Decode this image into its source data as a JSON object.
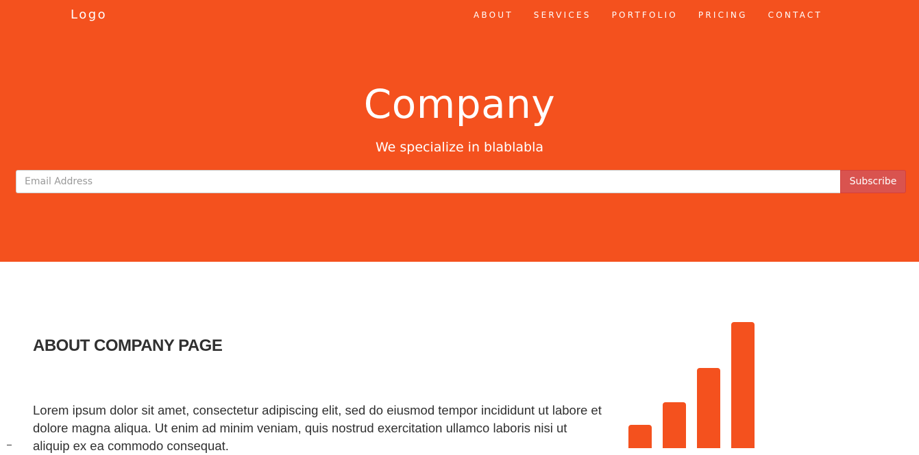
{
  "navbar": {
    "logo": "Logo",
    "links": [
      {
        "label": "ABOUT"
      },
      {
        "label": "SERVICES"
      },
      {
        "label": "PORTFOLIO"
      },
      {
        "label": "PRICING"
      },
      {
        "label": "CONTACT"
      }
    ]
  },
  "hero": {
    "title": "Company",
    "subtitle": "We specialize in blablabla",
    "email_placeholder": "Email Address",
    "email_value": "",
    "subscribe_label": "Subscribe"
  },
  "about": {
    "title": "ABOUT COMPANY PAGE",
    "text": "Lorem ipsum dolor sit amet, consectetur adipiscing elit, sed do eiusmod tempor incididunt ut labore et dolore magna aliqua. Ut enim ad minim veniam, quis nostrud exercitation ullamco laboris nisi ut aliquip ex ea commodo consequat."
  },
  "icons": {
    "about_icon": "signal-bars-icon"
  },
  "colors": {
    "brand": "#f4511e",
    "button": "#d9534f",
    "text": "#303030",
    "hero_text": "#ffffff"
  }
}
